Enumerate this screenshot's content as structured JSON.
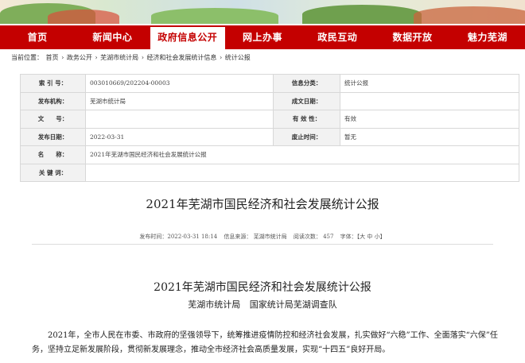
{
  "nav": {
    "items": [
      "首页",
      "新闻中心",
      "政府信息公开",
      "网上办事",
      "政民互动",
      "数据开放",
      "魅力芜湖"
    ],
    "active_index": 2,
    "color": "#c40000"
  },
  "breadcrumb": {
    "prefix": "当前位置：",
    "items": [
      "首页",
      "政务公开",
      "芜湖市统计局",
      "经济和社会发展统计信息",
      "统计公报"
    ],
    "separator": " › "
  },
  "info_table": {
    "index_label": "索 引 号：",
    "index_value": "003010669/202204-00003",
    "category_label": "信息分类：",
    "category_value": "统计公报",
    "publisher_label": "发布机构：",
    "publisher_value": "芜湖市统计局",
    "doc_date_label": "成文日期：",
    "doc_date_value": "",
    "doc_no_label": "文　　号：",
    "doc_no_value": "",
    "validity_label": "有 效 性：",
    "validity_value": "有效",
    "pub_date_label": "发布日期：",
    "pub_date_value": "2022-03-31",
    "expire_label": "废止时间：",
    "expire_value": "暂无",
    "name_label": "名　　称：",
    "name_value": "2021年芜湖市国民经济和社会发展统计公报",
    "keywords_label": "关 键 词：",
    "keywords_value": ""
  },
  "article": {
    "title": "2021年芜湖市国民经济和社会发展统计公报",
    "meta_time": "发布时间：2022-03-31 18:14",
    "meta_source": "信息来源：  芜湖市统计局",
    "meta_views": "阅读次数：  457",
    "meta_font": "字体：【大 中 小】",
    "heading": "2021年芜湖市国民经济和社会发展统计公报",
    "author1": "芜湖市统计局",
    "author2": "国家统计局芜湖调查队",
    "paragraph": "2021年，全市人民在市委、市政府的坚强领导下，统筹推进疫情防控和经济社会发展，扎实做好“六稳”工作、全面落实“六保”任务，坚持立足新发展阶段，贯彻新发展理念，推动全市经济社会高质量发展，实现“十四五”良好开局。"
  }
}
